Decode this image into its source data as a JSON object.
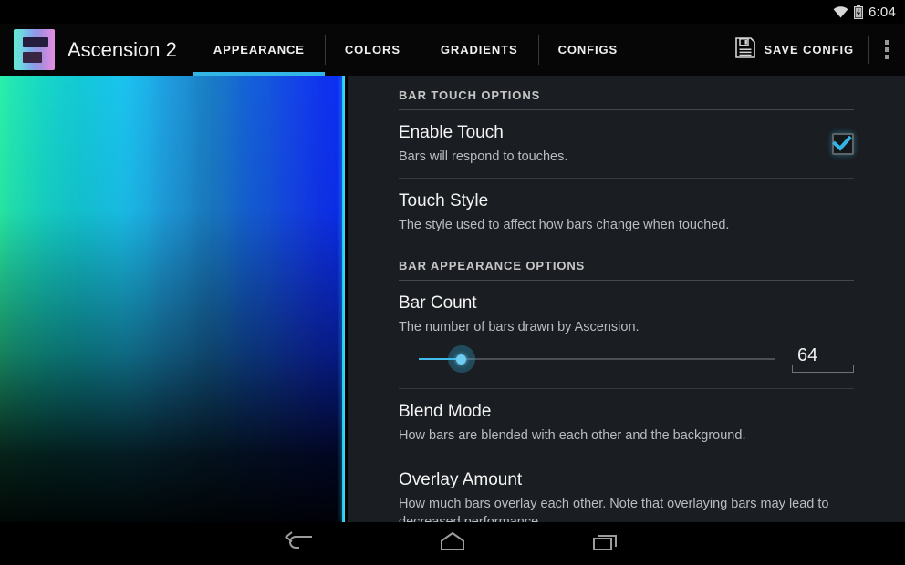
{
  "statusbar": {
    "time": "6:04",
    "icons": [
      "wifi-icon",
      "battery-charging-icon"
    ]
  },
  "actionbar": {
    "app_title": "Ascension 2",
    "app_icon": "ascension-app-icon",
    "tabs": [
      {
        "label": "APPEARANCE",
        "active": true
      },
      {
        "label": "COLORS",
        "active": false
      },
      {
        "label": "GRADIENTS",
        "active": false
      },
      {
        "label": "CONFIGS",
        "active": false
      }
    ],
    "save_label": "SAVE CONFIG",
    "save_icon": "floppy-disk-icon",
    "overflow_icon": "overflow-menu-icon",
    "accent_color": "#33b5e5"
  },
  "visualizer": {
    "name": "bar-visualizer-preview",
    "gradient_stops": [
      "#2af0a8",
      "#17d8c4",
      "#13c8d6",
      "#1bc2f0",
      "#1f9fe0",
      "#1a7fc4",
      "#1460d8",
      "#1443e8",
      "#0d2ff0"
    ]
  },
  "panel": {
    "sections": [
      {
        "header": "BAR TOUCH OPTIONS",
        "items": [
          {
            "title": "Enable Touch",
            "subtitle": "Bars will respond to touches.",
            "control": "checkbox",
            "checked": true
          },
          {
            "title": "Touch Style",
            "subtitle": "The style used to affect how bars change when touched.",
            "control": "none"
          }
        ]
      },
      {
        "header": "BAR APPEARANCE OPTIONS",
        "items": [
          {
            "title": "Bar Count",
            "subtitle": "The number of bars drawn by Ascension.",
            "control": "slider",
            "value": "64",
            "percent": 12
          },
          {
            "title": "Blend Mode",
            "subtitle": "How bars are blended with each other and the background.",
            "control": "none"
          },
          {
            "title": "Overlay Amount",
            "subtitle": "How much bars overlay each other. Note that overlaying bars may lead to decreased performance.",
            "control": "slider-cut"
          }
        ]
      }
    ]
  },
  "navbar": {
    "buttons": [
      {
        "name": "back-button",
        "icon": "back-arrow-icon"
      },
      {
        "name": "home-button",
        "icon": "home-icon"
      },
      {
        "name": "recents-button",
        "icon": "recents-icon"
      }
    ]
  }
}
